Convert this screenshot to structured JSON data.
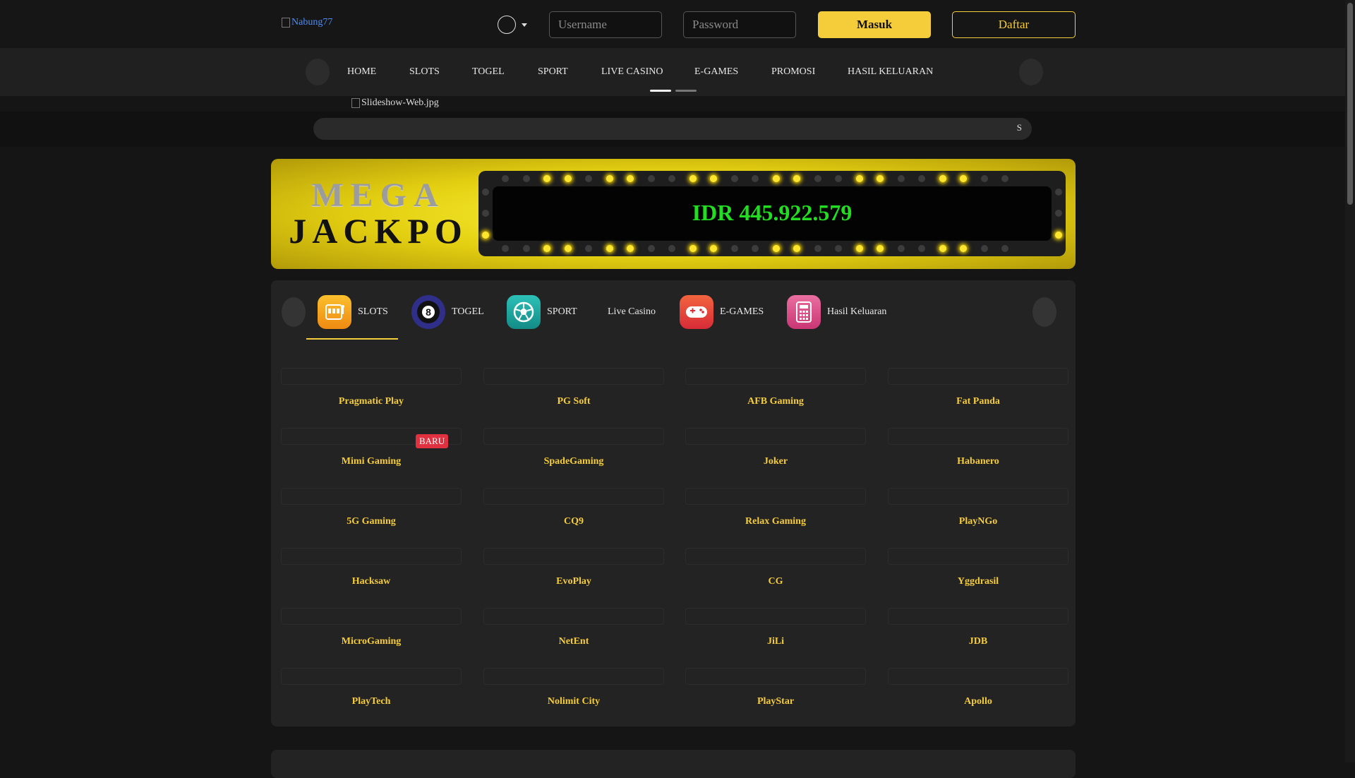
{
  "header": {
    "logo_alt": "Nabung77",
    "username_placeholder": "Username",
    "password_placeholder": "Password",
    "login_label": "Masuk",
    "register_label": "Daftar",
    "language_icon": "globe-icon",
    "brand_color": "#f5cc3a"
  },
  "nav": {
    "items": [
      "HOME",
      "SLOTS",
      "TOGEL",
      "SPORT",
      "LIVE CASINO",
      "E-GAMES",
      "PROMOSI",
      "HASIL KELUARAN"
    ]
  },
  "slideshow": {
    "image_alt": "Slideshow-Web.jpg",
    "active_slide": 1,
    "slide_count": 2
  },
  "marquee": {
    "text": "S"
  },
  "jackpot": {
    "title_line1": "MEGA",
    "title_line2": "JACKPO",
    "amount": "IDR  445.922.579"
  },
  "categories": {
    "active": "SLOTS",
    "items": [
      {
        "label": "SLOTS",
        "icon": "slot-machine-icon",
        "color": "#f3a21b"
      },
      {
        "label": "TOGEL",
        "icon": "eight-ball-icon",
        "color": "#2f2f8a"
      },
      {
        "label": "SPORT",
        "icon": "soccer-ball-icon",
        "color": "#1fa5a0"
      },
      {
        "label": "Live Casino",
        "icon": "",
        "color": ""
      },
      {
        "label": "E-GAMES",
        "icon": "gamepad-icon",
        "color": "#e94638"
      },
      {
        "label": "Hasil Keluaran",
        "icon": "calculator-icon",
        "color": "#d9437e"
      }
    ]
  },
  "providers": [
    {
      "name": "Pragmatic Play"
    },
    {
      "name": "PG Soft"
    },
    {
      "name": "AFB Gaming"
    },
    {
      "name": "Fat Panda"
    },
    {
      "name": "Mimi Gaming",
      "badge": "BARU"
    },
    {
      "name": "SpadeGaming"
    },
    {
      "name": "Joker"
    },
    {
      "name": "Habanero"
    },
    {
      "name": "5G Gaming"
    },
    {
      "name": "CQ9"
    },
    {
      "name": "Relax Gaming"
    },
    {
      "name": "PlayNGo"
    },
    {
      "name": "Hacksaw"
    },
    {
      "name": "EvoPlay"
    },
    {
      "name": "CG"
    },
    {
      "name": "Yggdrasil"
    },
    {
      "name": "MicroGaming"
    },
    {
      "name": "NetEnt"
    },
    {
      "name": "JiLi"
    },
    {
      "name": "JDB"
    },
    {
      "name": "PlayTech"
    },
    {
      "name": "Nolimit City"
    },
    {
      "name": "PlayStar"
    },
    {
      "name": "Apollo"
    }
  ]
}
